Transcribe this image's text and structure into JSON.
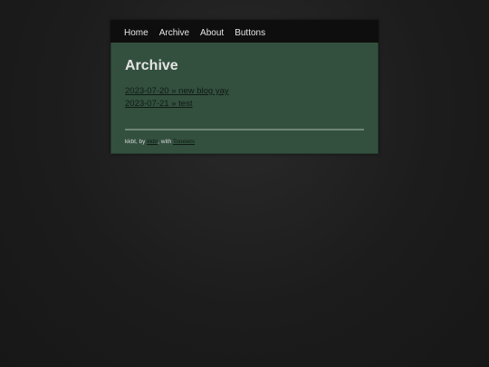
{
  "nav": {
    "items": [
      {
        "label": "Home"
      },
      {
        "label": "Archive"
      },
      {
        "label": "About"
      },
      {
        "label": "Buttons"
      }
    ]
  },
  "main": {
    "title": "Archive",
    "posts": [
      {
        "label": "2023-07-20 » new blog yay"
      },
      {
        "label": "2023-07-21 » test"
      }
    ]
  },
  "footer": {
    "prefix": "kkbt, by ",
    "author": "kkbt",
    "middle": ", with ",
    "engine": "Tonelets"
  }
}
